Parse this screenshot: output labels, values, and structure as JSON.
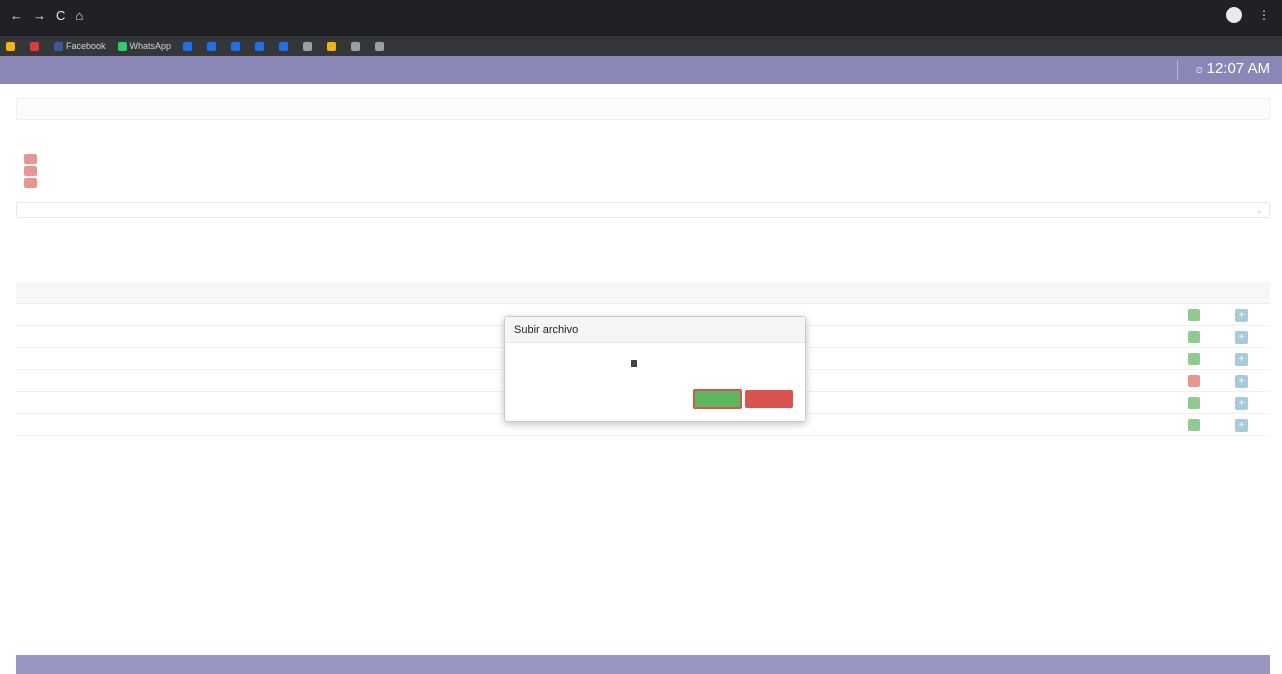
{
  "browser": {
    "back_icon": "←",
    "forward_icon": "→",
    "reload_icon": "C",
    "home_icon": "⌂",
    "url": "",
    "profile_name": "",
    "menu_icon": "⋮",
    "bookmarks": [
      {
        "label": "",
        "color": "#f4b400"
      },
      {
        "label": "",
        "color": "#e53935"
      },
      {
        "label": "Facebook",
        "color": "#3b5998"
      },
      {
        "label": "WhatsApp",
        "color": "#25d366"
      },
      {
        "label": "",
        "color": "#1a73e8"
      },
      {
        "label": "",
        "color": "#1a73e8"
      },
      {
        "label": "",
        "color": "#1a73e8"
      },
      {
        "label": "",
        "color": "#1a73e8"
      },
      {
        "label": "",
        "color": "#1a73e8"
      },
      {
        "label": "",
        "color": "#9aa0a6"
      },
      {
        "label": "",
        "color": "#f4b400"
      },
      {
        "label": "",
        "color": "#9aa0a6"
      },
      {
        "label": "",
        "color": "#9aa0a6"
      }
    ]
  },
  "app": {
    "logo_text": "",
    "user_text": "",
    "clock": "12:07 AM",
    "breadcrumb": "",
    "breadcrumb_right": ""
  },
  "info": {
    "lines": [
      "",
      "",
      "",
      ""
    ]
  },
  "select": {
    "text": "",
    "caret": "⌄"
  },
  "table": {
    "headers": {
      "left": "",
      "ver": "",
      "cargar": ""
    },
    "rows": [
      {
        "text": "",
        "status_color": "#8fcb8f"
      },
      {
        "text": "",
        "status_color": "#8fcb8f"
      },
      {
        "text": "",
        "status_color": "#8fcb8f"
      },
      {
        "text": "",
        "status_color": "#e8968f"
      },
      {
        "text": "",
        "status_color": "#8fcb8f"
      },
      {
        "text": "",
        "status_color": "#8fcb8f"
      }
    ],
    "upload_glyph": "+"
  },
  "footer": {
    "line1": "",
    "line2": ""
  },
  "modal": {
    "title": "Subir archivo",
    "file_label": "",
    "choose_file": "",
    "file_hint": "",
    "upload_button": "",
    "cancel_button": ""
  }
}
